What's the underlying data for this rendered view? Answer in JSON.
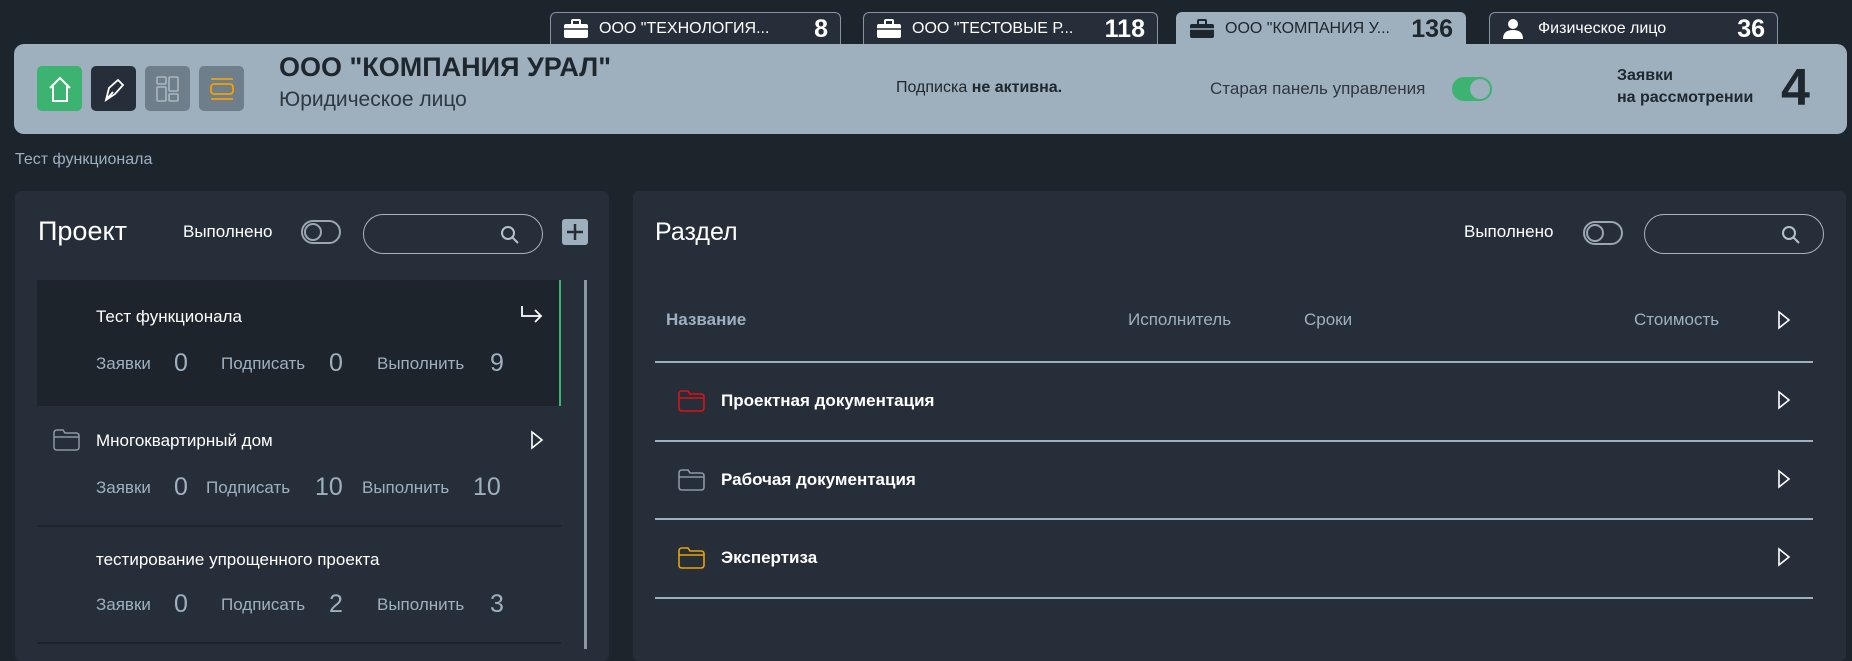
{
  "tabs": [
    {
      "label": "ООО \"ТЕХНОЛОГИЯ...",
      "count": "8",
      "icon": "briefcase-icon"
    },
    {
      "label": "ООО \"ТЕСТОВЫЕ Р...",
      "count": "118",
      "icon": "briefcase-icon"
    },
    {
      "label": "ООО \"КОМПАНИЯ У...",
      "count": "136",
      "icon": "briefcase-icon"
    },
    {
      "label": "Физическое лицо",
      "count": "36",
      "icon": "user-icon"
    }
  ],
  "header": {
    "company": "ООО \"КОМПАНИЯ УРАЛ\"",
    "type": "Юридическое лицо",
    "subscription_label": "Подписка",
    "subscription_status": "не активна.",
    "old_panel_label": "Старая панель управления",
    "old_panel_on": true,
    "pending_label_1": "Заявки",
    "pending_label_2": "на рассмотрении",
    "pending_count": "4"
  },
  "breadcrumb": "Тест функционала",
  "colors": {
    "green": "#3cb371",
    "header": "#9eafbd",
    "red": "#e01010",
    "orange": "#f0a000",
    "grey": "#8a98a5"
  },
  "project": {
    "title": "Проект",
    "done_label": "Выполнено",
    "items": [
      {
        "title": "Тест функционала",
        "requests_label": "Заявки",
        "requests": "0",
        "sign_label": "Подписать",
        "sign": "0",
        "do_label": "Выполнить",
        "do": "9"
      },
      {
        "title": "Многоквартирный дом",
        "requests_label": "Заявки",
        "requests": "0",
        "sign_label": "Подписать",
        "sign": "10",
        "do_label": "Выполнить",
        "do": "10"
      },
      {
        "title": "тестирование упрощенного проекта",
        "requests_label": "Заявки",
        "requests": "0",
        "sign_label": "Подписать",
        "sign": "2",
        "do_label": "Выполнить",
        "do": "3"
      }
    ]
  },
  "section": {
    "title": "Раздел",
    "done_label": "Выполнено",
    "columns": {
      "name": "Название",
      "executor": "Исполнитель",
      "terms": "Сроки",
      "cost": "Стоимость"
    },
    "rows": [
      {
        "title": "Проектная документация",
        "folder_color": "#e01010"
      },
      {
        "title": "Рабочая документация",
        "folder_color": "#8a98a5"
      },
      {
        "title": "Экспертиза",
        "folder_color": "#f0a000"
      }
    ]
  }
}
